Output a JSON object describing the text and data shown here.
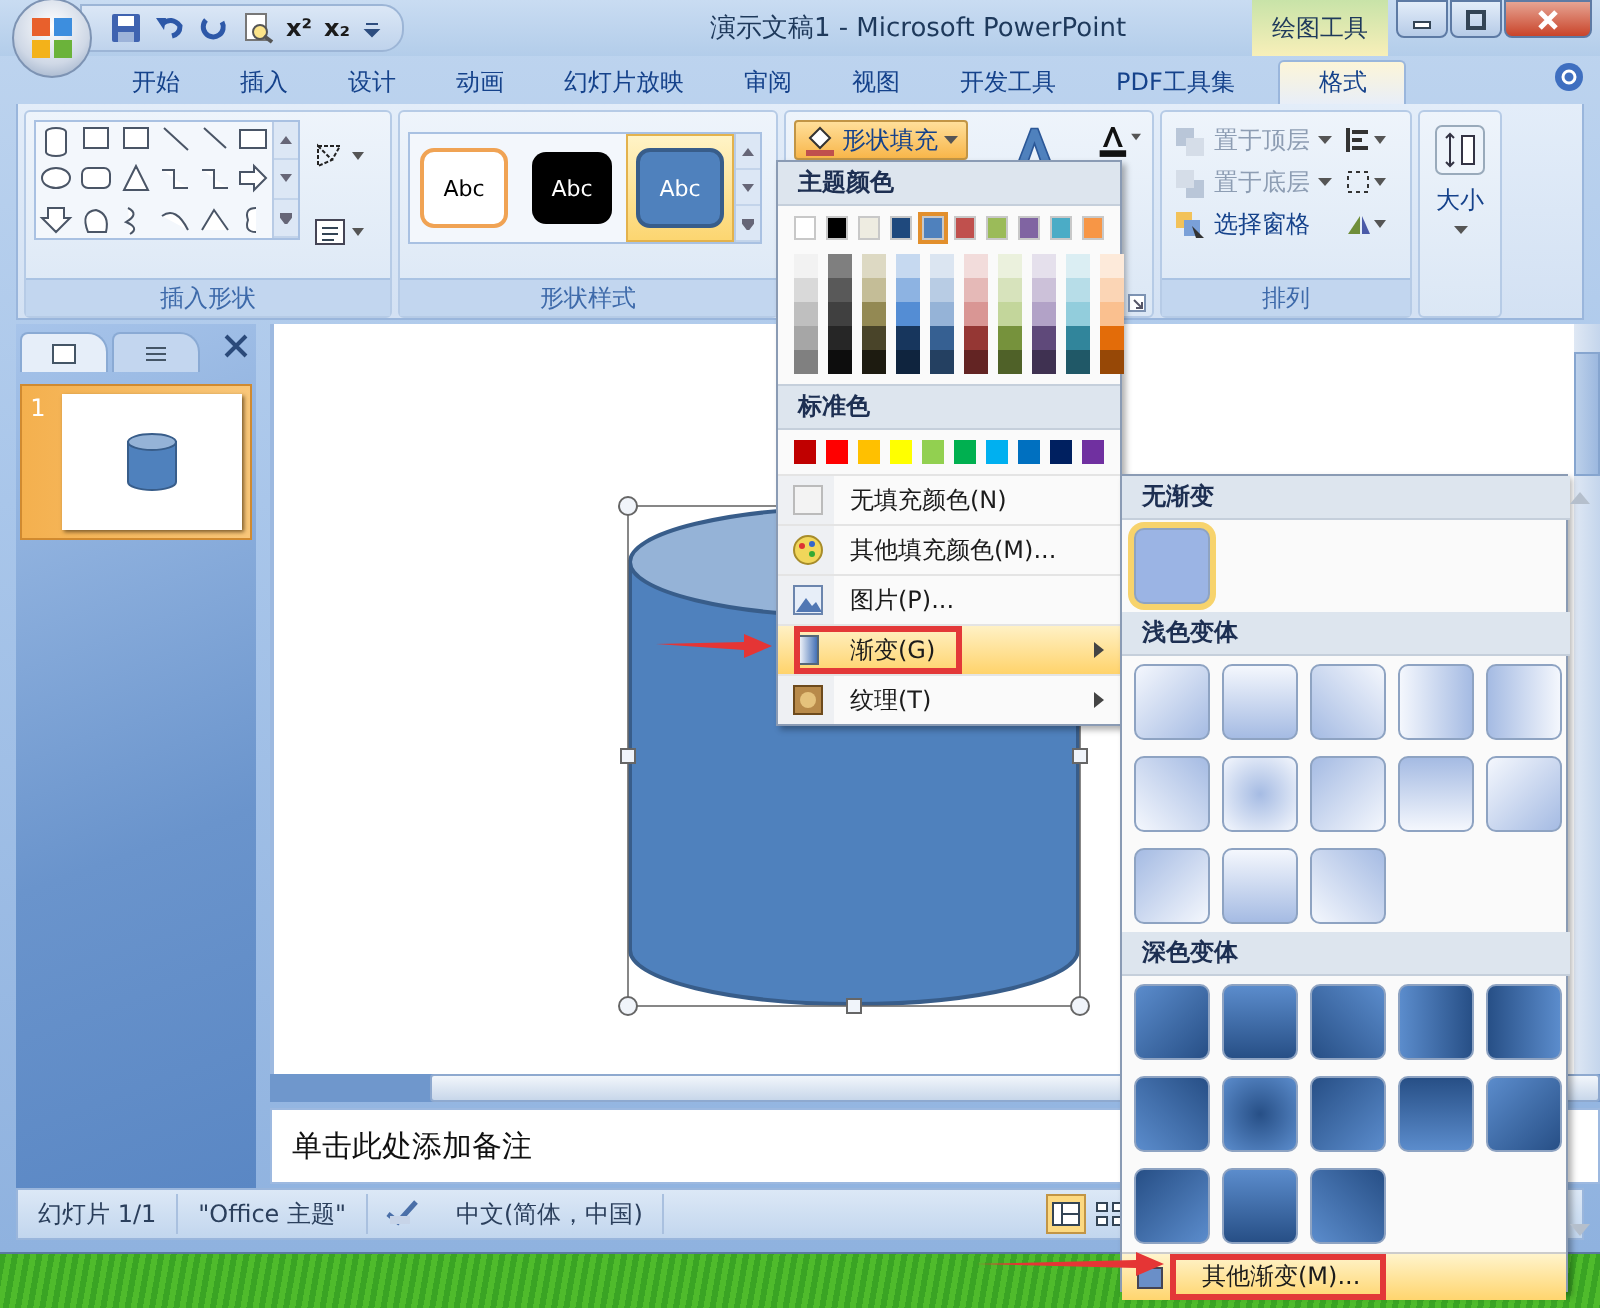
{
  "window": {
    "title": "演示文稿1 - Microsoft PowerPoint",
    "context_tab": "绘图工具"
  },
  "quick_access": [
    {
      "kind": "save"
    },
    {
      "kind": "undo"
    },
    {
      "kind": "redo"
    },
    {
      "kind": "preview"
    },
    {
      "kind": "superscript",
      "text": "x²"
    },
    {
      "kind": "subscript",
      "text": "x₂"
    },
    {
      "kind": "customize"
    }
  ],
  "tabs": [
    {
      "label": "开始",
      "selected": false
    },
    {
      "label": "插入",
      "selected": false
    },
    {
      "label": "设计",
      "selected": false
    },
    {
      "label": "动画",
      "selected": false
    },
    {
      "label": "幻灯片放映",
      "selected": false
    },
    {
      "label": "审阅",
      "selected": false
    },
    {
      "label": "视图",
      "selected": false
    },
    {
      "label": "开发工具",
      "selected": false
    },
    {
      "label": "PDF工具集",
      "selected": false
    },
    {
      "label": "格式",
      "selected": true
    }
  ],
  "ribbon": {
    "insert_shapes": {
      "label": "插入形状"
    },
    "shape_styles": {
      "label": "形状样式",
      "styles": [
        {
          "text": "Abc",
          "kind": "outline",
          "selected": false
        },
        {
          "text": "Abc",
          "kind": "black",
          "selected": false
        },
        {
          "text": "Abc",
          "kind": "blue",
          "selected": true
        }
      ]
    },
    "shape_fill": {
      "label": "形状填充",
      "open": true
    },
    "arrange": {
      "label": "排列",
      "items": [
        {
          "label": "置于顶层",
          "kind": "front",
          "disabled": true
        },
        {
          "label": "置于底层",
          "kind": "back",
          "disabled": true
        },
        {
          "label": "选择窗格",
          "kind": "pane",
          "disabled": false
        }
      ]
    },
    "size": {
      "label": "大小"
    }
  },
  "pane_tabs": [
    {
      "kind": "slides",
      "selected": true
    },
    {
      "kind": "outline",
      "selected": false
    }
  ],
  "slides": [
    {
      "number": "1",
      "selected": true
    }
  ],
  "notes": {
    "placeholder": "单击此处添加备注"
  },
  "status_bar": {
    "slide_info": "幻灯片 1/1",
    "theme": "\"Office 主题\"",
    "language": "中文(简体，中国)",
    "views": [
      {
        "kind": "normal",
        "selected": true
      },
      {
        "kind": "sorter",
        "selected": false
      }
    ]
  },
  "fill_menu": {
    "theme_title": "主题颜色",
    "theme_colors": [
      {
        "color": "#ffffff",
        "selected": false,
        "shades": [
          {
            "color": "#f2f2f2"
          },
          {
            "color": "#d9d9d9"
          },
          {
            "color": "#bfbfbf"
          },
          {
            "color": "#a6a6a6"
          },
          {
            "color": "#808080"
          }
        ]
      },
      {
        "color": "#000000",
        "selected": false,
        "shades": [
          {
            "color": "#7f7f7f"
          },
          {
            "color": "#595959"
          },
          {
            "color": "#404040"
          },
          {
            "color": "#262626"
          },
          {
            "color": "#0d0d0d"
          }
        ]
      },
      {
        "color": "#eeece1",
        "selected": false,
        "shades": [
          {
            "color": "#ddd9c3"
          },
          {
            "color": "#c4bd97"
          },
          {
            "color": "#938953"
          },
          {
            "color": "#494429"
          },
          {
            "color": "#1d1b10"
          }
        ]
      },
      {
        "color": "#1f497d",
        "selected": false,
        "shades": [
          {
            "color": "#c6d9f0"
          },
          {
            "color": "#8db3e2"
          },
          {
            "color": "#548dd4"
          },
          {
            "color": "#17365d"
          },
          {
            "color": "#0f243e"
          }
        ]
      },
      {
        "color": "#4f81bd",
        "selected": true,
        "shades": [
          {
            "color": "#dbe5f1"
          },
          {
            "color": "#b8cce4"
          },
          {
            "color": "#95b3d7"
          },
          {
            "color": "#366092"
          },
          {
            "color": "#244061"
          }
        ]
      },
      {
        "color": "#c0504d",
        "selected": false,
        "shades": [
          {
            "color": "#f2dcdb"
          },
          {
            "color": "#e5b9b7"
          },
          {
            "color": "#d99694"
          },
          {
            "color": "#953734"
          },
          {
            "color": "#632423"
          }
        ]
      },
      {
        "color": "#9bbb59",
        "selected": false,
        "shades": [
          {
            "color": "#ebf1dd"
          },
          {
            "color": "#d7e3bc"
          },
          {
            "color": "#c3d69b"
          },
          {
            "color": "#76923c"
          },
          {
            "color": "#4f6128"
          }
        ]
      },
      {
        "color": "#8064a2",
        "selected": false,
        "shades": [
          {
            "color": "#e5e0ec"
          },
          {
            "color": "#ccc1d9"
          },
          {
            "color": "#b2a2c7"
          },
          {
            "color": "#5f497a"
          },
          {
            "color": "#3f3151"
          }
        ]
      },
      {
        "color": "#4bacc6",
        "selected": false,
        "shades": [
          {
            "color": "#dbeef3"
          },
          {
            "color": "#b7dde8"
          },
          {
            "color": "#92cddc"
          },
          {
            "color": "#31859b"
          },
          {
            "color": "#205867"
          }
        ]
      },
      {
        "color": "#f79646",
        "selected": false,
        "shades": [
          {
            "color": "#fdeada"
          },
          {
            "color": "#fbd5b5"
          },
          {
            "color": "#fac08f"
          },
          {
            "color": "#e36c09"
          },
          {
            "color": "#974806"
          }
        ]
      }
    ],
    "standard_title": "标准色",
    "standard_colors": [
      {
        "color": "#c00000"
      },
      {
        "color": "#ff0000"
      },
      {
        "color": "#ffc000"
      },
      {
        "color": "#ffff00"
      },
      {
        "color": "#92d050"
      },
      {
        "color": "#00b050"
      },
      {
        "color": "#00b0f0"
      },
      {
        "color": "#0070c0"
      },
      {
        "color": "#002060"
      },
      {
        "color": "#7030a0"
      }
    ],
    "items": [
      {
        "label": "无填充颜色(N)",
        "kind": "none",
        "submenu": false,
        "selected": false,
        "annotated": false
      },
      {
        "label": "其他填充颜色(M)...",
        "kind": "palette",
        "submenu": false,
        "selected": false,
        "annotated": false
      },
      {
        "label": "图片(P)...",
        "kind": "picture",
        "submenu": false,
        "selected": false,
        "annotated": false
      },
      {
        "label": "渐变(G)",
        "kind": "gradient",
        "submenu": true,
        "selected": true,
        "annotated": true
      },
      {
        "label": "纹理(T)",
        "kind": "texture",
        "submenu": true,
        "selected": false,
        "annotated": false
      }
    ]
  },
  "gradient_menu": {
    "sections": [
      {
        "title": "无渐变",
        "kind": "none",
        "swatches": [
          {
            "selected": true
          }
        ]
      },
      {
        "title": "浅色变体",
        "kind": "light",
        "swatches": [
          {
            "selected": false
          },
          {
            "selected": false
          },
          {
            "selected": false
          },
          {
            "selected": false
          },
          {
            "selected": false
          },
          {
            "selected": false
          },
          {
            "selected": false
          },
          {
            "selected": false
          },
          {
            "selected": false
          },
          {
            "selected": false
          },
          {
            "selected": false
          },
          {
            "selected": false
          },
          {
            "selected": false
          }
        ]
      },
      {
        "title": "深色变体",
        "kind": "dark",
        "swatches": [
          {
            "selected": false
          },
          {
            "selected": false
          },
          {
            "selected": false
          },
          {
            "selected": false
          },
          {
            "selected": false
          },
          {
            "selected": false
          },
          {
            "selected": false
          },
          {
            "selected": false
          },
          {
            "selected": false
          },
          {
            "selected": false
          },
          {
            "selected": false
          },
          {
            "selected": false
          },
          {
            "selected": false
          }
        ]
      }
    ],
    "footer": {
      "label": "其他渐变(M)...",
      "annotated": true
    }
  }
}
